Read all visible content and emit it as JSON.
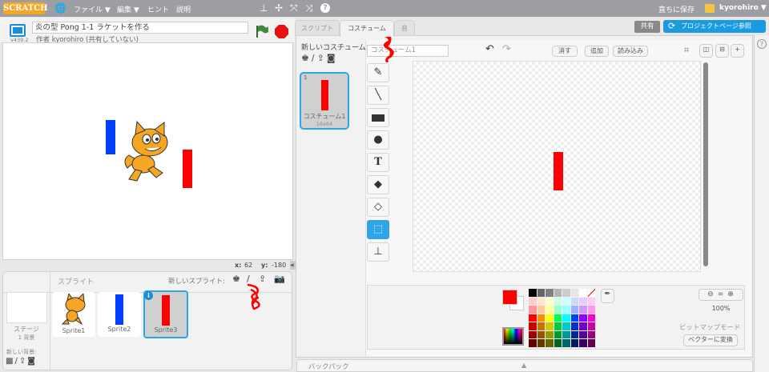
{
  "topbar": {
    "logo": "SCRATCH",
    "menus": [
      "ファイル ▼",
      "編集 ▼",
      "ヒント",
      "説明"
    ],
    "save_now": "直ちに保存",
    "username": "kyorohiro ▼",
    "icons": [
      "globe-icon",
      "duplicate-stamp-icon",
      "cut-icon",
      "grow-icon",
      "shrink-icon",
      "help-icon"
    ]
  },
  "stage_header": {
    "version": "v439.2",
    "project_title": "炎の型 Pong 1-1 ラケットを作る",
    "author": "作者 kyorohiro (共有していない)"
  },
  "stage": {
    "coord_x_label": "x:",
    "coord_x": "62",
    "coord_y_label": "y:",
    "coord_y": "-180"
  },
  "sprites_pane": {
    "title": "スプライト",
    "new_sprite": "新しいスプライト:",
    "stage_label": "ステージ",
    "stage_backdrops": "1 背景",
    "new_backdrop": "新しい背景:",
    "sprites": [
      {
        "name": "Sprite1",
        "color": "#f5a623"
      },
      {
        "name": "Sprite2",
        "color": "#0040ff"
      },
      {
        "name": "Sprite3",
        "color": "#ff0000",
        "selected": true
      }
    ]
  },
  "tabs": [
    "スクリプト",
    "コスチューム",
    "音"
  ],
  "active_tab": "コスチューム",
  "header_buttons": {
    "share": "共有",
    "see_project_page": "プロジェクトページ参照"
  },
  "costumes": {
    "new_costume": "新しいコスチューム:",
    "list": [
      {
        "index": "1",
        "name": "コスチューム1",
        "size": "16x64"
      }
    ]
  },
  "paint_editor": {
    "costume_name": "コスチューム1",
    "buttons": [
      "消す",
      "追加",
      "読み込み"
    ],
    "tools": [
      "brush-icon",
      "line-icon",
      "rectangle-icon",
      "ellipse-icon",
      "text-icon",
      "fill-icon",
      "eraser-icon",
      "select-icon",
      "stamp-icon"
    ],
    "selected_tool": "select-icon",
    "zoom": "100%",
    "mode": "ビットマップモード",
    "convert": "ベクターに変換",
    "primary_color": "#ff0000",
    "secondary_color": "#ffffff",
    "palette": [
      [
        "#000000",
        "#666666",
        "#808080",
        "#b3b3b3",
        "#cccccc",
        "#e6e6e6",
        "#ffffff",
        "transparent"
      ],
      [
        "#ffcccc",
        "#ffe5cc",
        "#ffffcc",
        "#ccffe5",
        "#ccffff",
        "#ccd9ff",
        "#e5ccff",
        "#ffccf2"
      ],
      [
        "#ff9999",
        "#ffcc99",
        "#ffff99",
        "#99ffcc",
        "#99ffff",
        "#99b3ff",
        "#cc99ff",
        "#ff99e5"
      ],
      [
        "#ff0000",
        "#ff8c00",
        "#ffff00",
        "#00ff4c",
        "#00ffff",
        "#0040ff",
        "#8c00ff",
        "#ff00cc"
      ],
      [
        "#cc0000",
        "#cc7000",
        "#cccc00",
        "#00cc3d",
        "#00cccc",
        "#0033cc",
        "#7000cc",
        "#cc00a3"
      ],
      [
        "#990000",
        "#995400",
        "#999900",
        "#00992e",
        "#009999",
        "#002699",
        "#540099",
        "#99007a"
      ],
      [
        "#660000",
        "#663800",
        "#666600",
        "#00661f",
        "#006666",
        "#001a66",
        "#380066",
        "#660052"
      ]
    ]
  },
  "backpack": "バックパック"
}
